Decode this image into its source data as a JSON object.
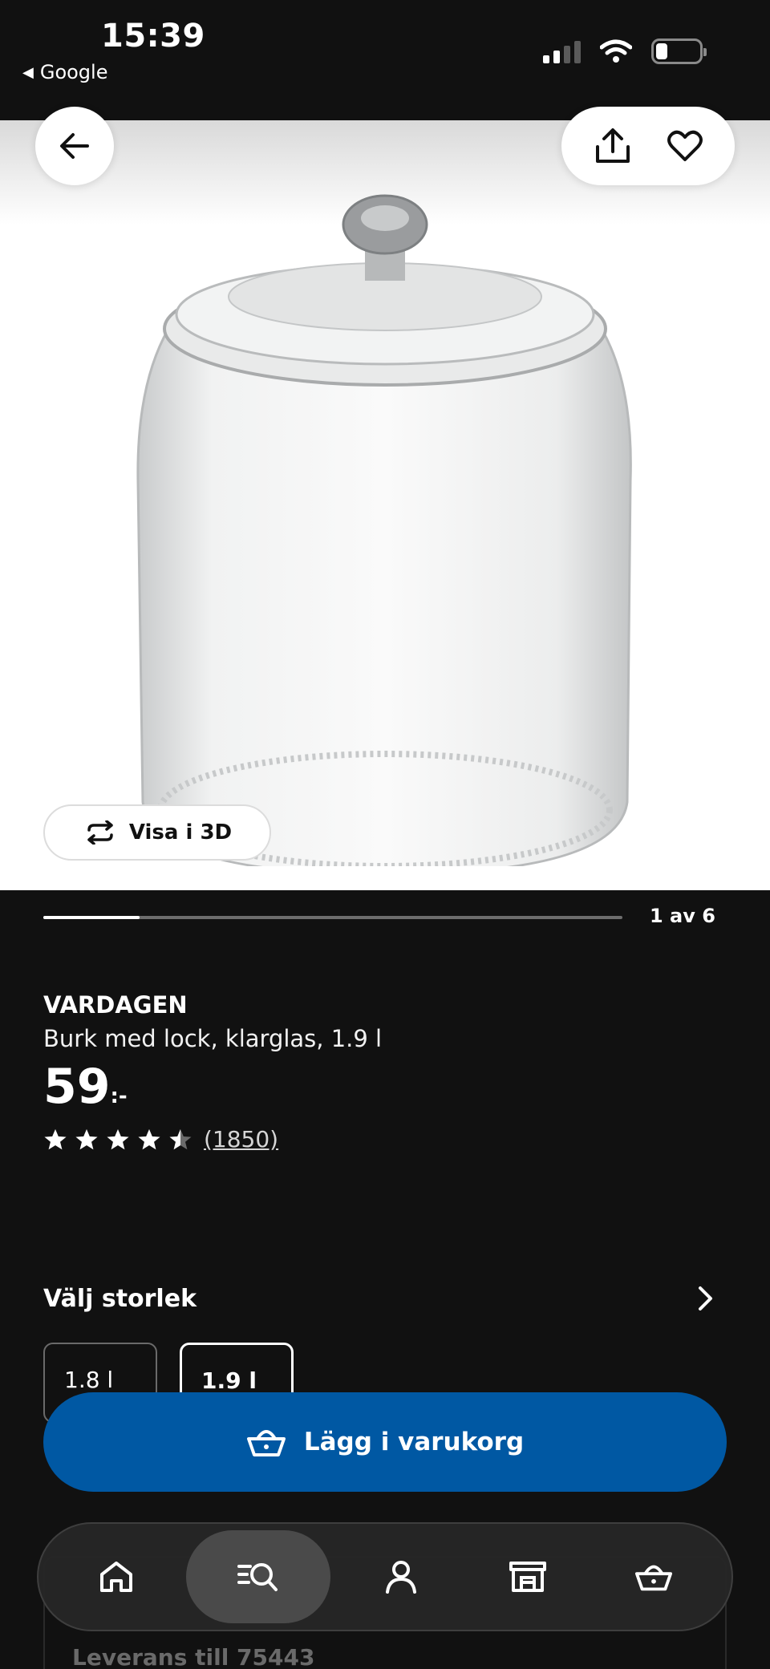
{
  "status_bar": {
    "time": "15:39",
    "back_app": "Google"
  },
  "gallery": {
    "view_3d_label": "Visa i 3D",
    "counter": "1 av 6",
    "progress": 0.166
  },
  "product": {
    "brand": "VARDAGEN",
    "description": "Burk med lock, klarglas, 1.9 l",
    "price_main": "59",
    "price_suffix": ":-",
    "rating": 4.5,
    "review_count": "(1850)"
  },
  "size": {
    "title": "Välj storlek",
    "options": [
      {
        "label": "1.8 l",
        "selected": false
      },
      {
        "label": "1.9 l",
        "selected": true
      }
    ]
  },
  "cart": {
    "label": "Lägg i varukorg"
  },
  "behind": {
    "delivery_text": "Leverans till 75443"
  },
  "nav": {
    "items": [
      {
        "icon": "home-icon"
      },
      {
        "icon": "search-icon",
        "active": true
      },
      {
        "icon": "profile-icon"
      },
      {
        "icon": "store-icon"
      },
      {
        "icon": "cart-icon"
      }
    ]
  },
  "colors": {
    "accent": "#0058a3",
    "background": "#111111"
  }
}
